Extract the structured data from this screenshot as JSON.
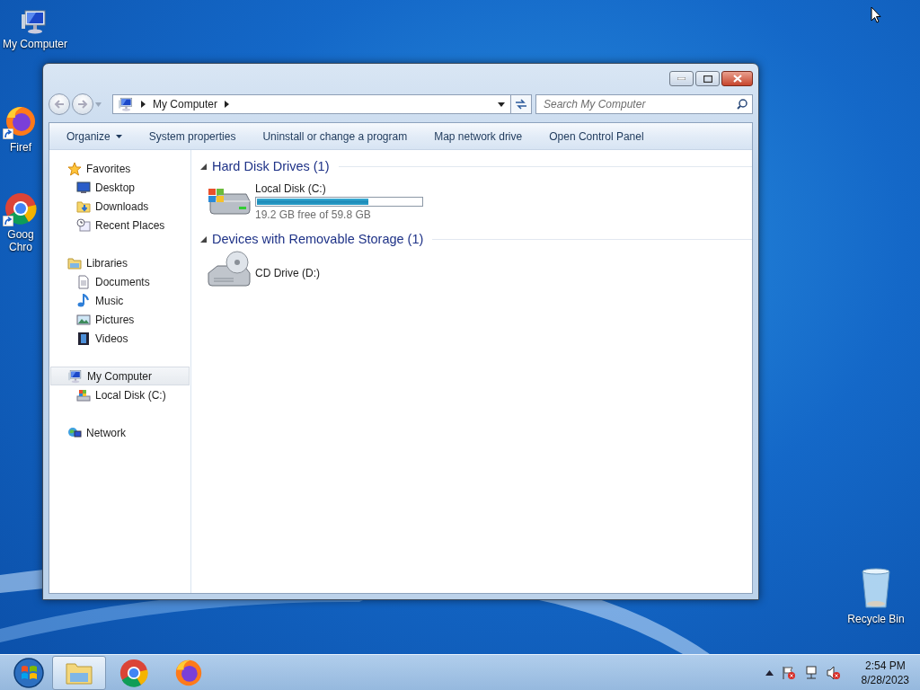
{
  "desktop_icons": [
    {
      "label": "My Computer",
      "kind": "computer",
      "shortcut": false
    },
    {
      "label": "Firef",
      "kind": "firefox",
      "shortcut": true
    },
    {
      "label": "Goog Chro",
      "kind": "chrome",
      "shortcut": true
    },
    {
      "label": "Recycle Bin",
      "kind": "recycle",
      "shortcut": false
    }
  ],
  "window": {
    "address": {
      "path": [
        "My Computer"
      ]
    },
    "search": {
      "placeholder": "Search My Computer"
    },
    "toolbar": [
      {
        "label": "Organize",
        "dropdown": true
      },
      {
        "label": "System properties",
        "dropdown": false
      },
      {
        "label": "Uninstall or change a program",
        "dropdown": false
      },
      {
        "label": "Map network drive",
        "dropdown": false
      },
      {
        "label": "Open Control Panel",
        "dropdown": false
      }
    ],
    "sidebar": [
      {
        "label": "Favorites",
        "kind": "star",
        "selected": false,
        "children": [
          {
            "label": "Desktop",
            "kind": "desktop",
            "selected": false
          },
          {
            "label": "Downloads",
            "kind": "downloads",
            "selected": false
          },
          {
            "label": "Recent Places",
            "kind": "recent",
            "selected": false
          }
        ]
      },
      {
        "label": "Libraries",
        "kind": "libraries",
        "selected": false,
        "children": [
          {
            "label": "Documents",
            "kind": "documents",
            "selected": false
          },
          {
            "label": "Music",
            "kind": "music",
            "selected": false
          },
          {
            "label": "Pictures",
            "kind": "pictures",
            "selected": false
          },
          {
            "label": "Videos",
            "kind": "videos",
            "selected": false
          }
        ]
      },
      {
        "label": "My Computer",
        "kind": "computer",
        "selected": true,
        "children": [
          {
            "label": "Local Disk (C:)",
            "kind": "localdisk",
            "selected": false
          }
        ]
      },
      {
        "label": "Network",
        "kind": "network",
        "selected": false
      }
    ],
    "sections": [
      {
        "title": "Hard Disk Drives (1)",
        "expanded": true,
        "items": [
          {
            "name": "Local Disk (C:)",
            "kind": "disk",
            "level": 0.68,
            "detail": "19.2 GB free of 59.8 GB"
          }
        ]
      },
      {
        "title": "Devices with Removable Storage (1)",
        "expanded": true,
        "items": [
          {
            "name": "CD Drive (D:)",
            "kind": "cd"
          }
        ]
      }
    ]
  },
  "taskbar": {
    "buttons": [
      {
        "kind": "explorer",
        "selected": true
      },
      {
        "kind": "chrome",
        "selected": false
      },
      {
        "kind": "firefox",
        "selected": false
      }
    ],
    "time": "2:54 PM",
    "date": "8/28/2023"
  }
}
